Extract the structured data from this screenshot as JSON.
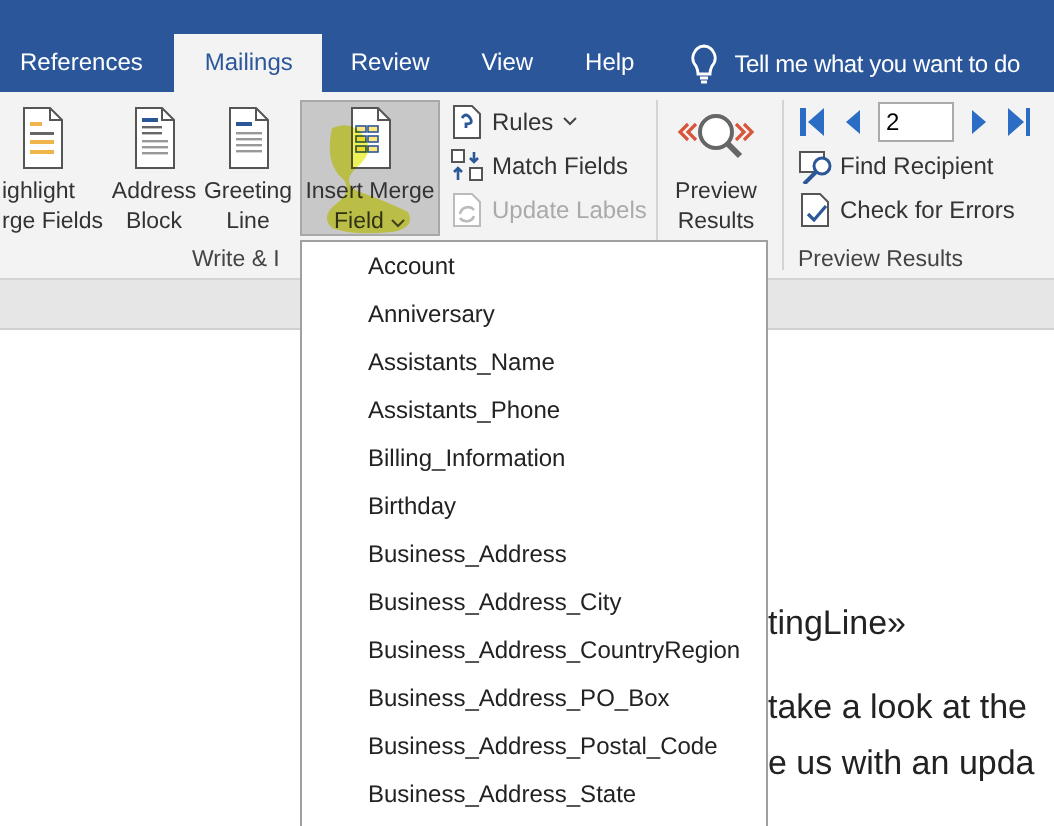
{
  "tabs": [
    {
      "label": "References",
      "selected": false
    },
    {
      "label": "Mailings",
      "selected": true
    },
    {
      "label": "Review",
      "selected": false
    },
    {
      "label": "View",
      "selected": false
    },
    {
      "label": "Help",
      "selected": false
    }
  ],
  "tell_me": "Tell me what you want to do",
  "write_insert": {
    "label": "Write & I",
    "large_buttons": [
      {
        "kind": "highlight",
        "lines": [
          "ighlight",
          "rge Fields"
        ],
        "selected": false
      },
      {
        "kind": "address",
        "lines": [
          "Address",
          "Block"
        ],
        "selected": false
      },
      {
        "kind": "greeting",
        "lines": [
          "Greeting",
          "Line"
        ],
        "selected": false
      },
      {
        "kind": "merge",
        "lines": [
          "Insert Merge",
          "Field"
        ],
        "selected": true
      }
    ],
    "small_buttons": [
      {
        "kind": "rules",
        "label": "Rules",
        "disabled": false
      },
      {
        "kind": "match",
        "label": "Match Fields",
        "disabled": false
      },
      {
        "kind": "update",
        "label": "Update Labels",
        "disabled": true
      }
    ]
  },
  "preview_button": {
    "lines": [
      "Preview",
      "Results"
    ]
  },
  "preview_results": {
    "label": "Preview Results",
    "record": "2",
    "actions": [
      {
        "kind": "find",
        "label": "Find Recipient"
      },
      {
        "kind": "check",
        "label": "Check for Errors"
      }
    ]
  },
  "merge_field_menu": {
    "items": [
      "Account",
      "Anniversary",
      "Assistants_Name",
      "Assistants_Phone",
      "Billing_Information",
      "Birthday",
      "Business_Address",
      "Business_Address_City",
      "Business_Address_CountryRegion",
      "Business_Address_PO_Box",
      "Business_Address_Postal_Code",
      "Business_Address_State"
    ]
  },
  "document": {
    "lines": [
      "tingLine»",
      "take a look at the",
      "e us with an upda"
    ]
  }
}
